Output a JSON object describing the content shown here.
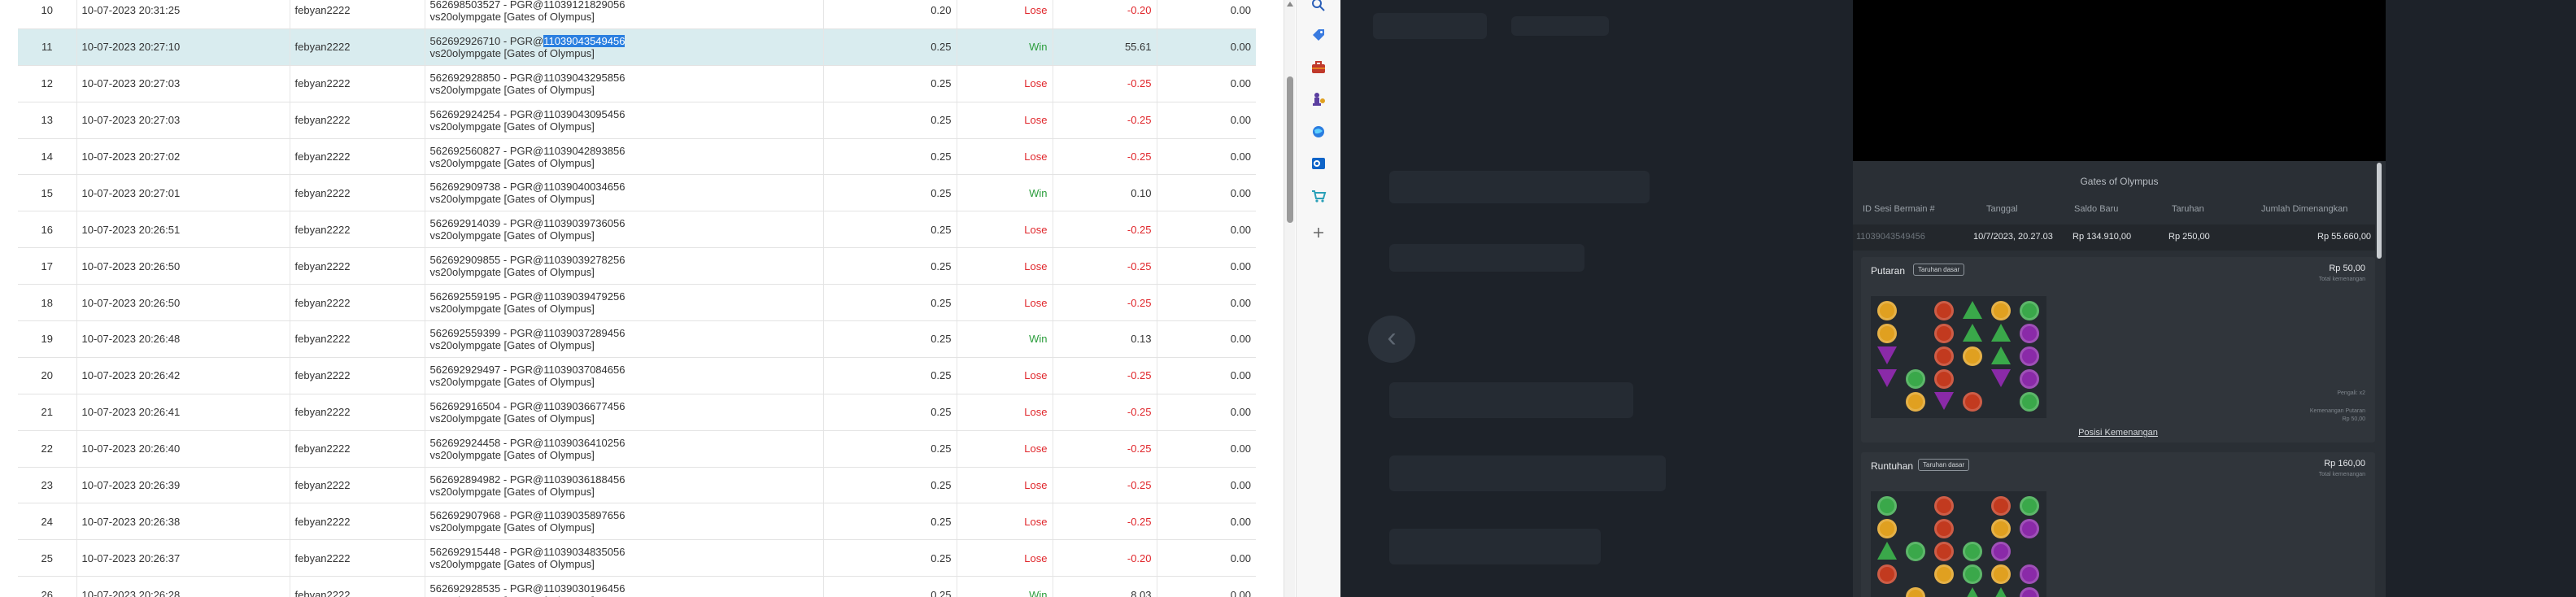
{
  "table": {
    "rows": [
      {
        "no": "10",
        "datetime": "10-07-2023 20:31:25",
        "user": "febyan2222",
        "ref_id": "562698503527",
        "ref_code": "PGR@11039121829056",
        "game": "vs20olympgate [Gates of Olympus]",
        "bet": "0.20",
        "result": "Lose",
        "winloss": "-0.20",
        "extra": "0.00"
      },
      {
        "no": "11",
        "datetime": "10-07-2023 20:27:10",
        "user": "febyan2222",
        "ref_id": "562692926710",
        "ref_code": "PGR@11039043549456",
        "game": "vs20olympgate [Gates of Olympus]",
        "bet": "0.25",
        "result": "Win",
        "winloss": "55.61",
        "extra": "0.00"
      },
      {
        "no": "12",
        "datetime": "10-07-2023 20:27:03",
        "user": "febyan2222",
        "ref_id": "562692928850",
        "ref_code": "PGR@11039043295856",
        "game": "vs20olympgate [Gates of Olympus]",
        "bet": "0.25",
        "result": "Lose",
        "winloss": "-0.25",
        "extra": "0.00"
      },
      {
        "no": "13",
        "datetime": "10-07-2023 20:27:03",
        "user": "febyan2222",
        "ref_id": "562692924254",
        "ref_code": "PGR@11039043095456",
        "game": "vs20olympgate [Gates of Olympus]",
        "bet": "0.25",
        "result": "Lose",
        "winloss": "-0.25",
        "extra": "0.00"
      },
      {
        "no": "14",
        "datetime": "10-07-2023 20:27:02",
        "user": "febyan2222",
        "ref_id": "562692560827",
        "ref_code": "PGR@11039042893856",
        "game": "vs20olympgate [Gates of Olympus]",
        "bet": "0.25",
        "result": "Lose",
        "winloss": "-0.25",
        "extra": "0.00"
      },
      {
        "no": "15",
        "datetime": "10-07-2023 20:27:01",
        "user": "febyan2222",
        "ref_id": "562692909738",
        "ref_code": "PGR@11039040034656",
        "game": "vs20olympgate [Gates of Olympus]",
        "bet": "0.25",
        "result": "Win",
        "winloss": "0.10",
        "extra": "0.00"
      },
      {
        "no": "16",
        "datetime": "10-07-2023 20:26:51",
        "user": "febyan2222",
        "ref_id": "562692914039",
        "ref_code": "PGR@11039039736056",
        "game": "vs20olympgate [Gates of Olympus]",
        "bet": "0.25",
        "result": "Lose",
        "winloss": "-0.25",
        "extra": "0.00"
      },
      {
        "no": "17",
        "datetime": "10-07-2023 20:26:50",
        "user": "febyan2222",
        "ref_id": "562692909855",
        "ref_code": "PGR@11039039278256",
        "game": "vs20olympgate [Gates of Olympus]",
        "bet": "0.25",
        "result": "Lose",
        "winloss": "-0.25",
        "extra": "0.00"
      },
      {
        "no": "18",
        "datetime": "10-07-2023 20:26:50",
        "user": "febyan2222",
        "ref_id": "562692559195",
        "ref_code": "PGR@11039039479256",
        "game": "vs20olympgate [Gates of Olympus]",
        "bet": "0.25",
        "result": "Lose",
        "winloss": "-0.25",
        "extra": "0.00"
      },
      {
        "no": "19",
        "datetime": "10-07-2023 20:26:48",
        "user": "febyan2222",
        "ref_id": "562692559399",
        "ref_code": "PGR@11039037289456",
        "game": "vs20olympgate [Gates of Olympus]",
        "bet": "0.25",
        "result": "Win",
        "winloss": "0.13",
        "extra": "0.00"
      },
      {
        "no": "20",
        "datetime": "10-07-2023 20:26:42",
        "user": "febyan2222",
        "ref_id": "562692929497",
        "ref_code": "PGR@11039037084656",
        "game": "vs20olympgate [Gates of Olympus]",
        "bet": "0.25",
        "result": "Lose",
        "winloss": "-0.25",
        "extra": "0.00"
      },
      {
        "no": "21",
        "datetime": "10-07-2023 20:26:41",
        "user": "febyan2222",
        "ref_id": "562692916504",
        "ref_code": "PGR@11039036677456",
        "game": "vs20olympgate [Gates of Olympus]",
        "bet": "0.25",
        "result": "Lose",
        "winloss": "-0.25",
        "extra": "0.00"
      },
      {
        "no": "22",
        "datetime": "10-07-2023 20:26:40",
        "user": "febyan2222",
        "ref_id": "562692924458",
        "ref_code": "PGR@11039036410256",
        "game": "vs20olympgate [Gates of Olympus]",
        "bet": "0.25",
        "result": "Lose",
        "winloss": "-0.25",
        "extra": "0.00"
      },
      {
        "no": "23",
        "datetime": "10-07-2023 20:26:39",
        "user": "febyan2222",
        "ref_id": "562692894982",
        "ref_code": "PGR@11039036188456",
        "game": "vs20olympgate [Gates of Olympus]",
        "bet": "0.25",
        "result": "Lose",
        "winloss": "-0.25",
        "extra": "0.00"
      },
      {
        "no": "24",
        "datetime": "10-07-2023 20:26:38",
        "user": "febyan2222",
        "ref_id": "562692907968",
        "ref_code": "PGR@11039035897656",
        "game": "vs20olympgate [Gates of Olympus]",
        "bet": "0.25",
        "result": "Lose",
        "winloss": "-0.25",
        "extra": "0.00"
      },
      {
        "no": "25",
        "datetime": "10-07-2023 20:26:37",
        "user": "febyan2222",
        "ref_id": "562692915448",
        "ref_code": "PGR@11039034835056",
        "game": "vs20olympgate [Gates of Olympus]",
        "bet": "0.25",
        "result": "Lose",
        "winloss": "-0.20",
        "extra": "0.00"
      },
      {
        "no": "26",
        "datetime": "10-07-2023 20:26:28",
        "user": "febyan2222",
        "ref_id": "562692928535",
        "ref_code": "PGR@11039030196456",
        "game": "vs20olympgate [Gates of Olympus]",
        "bet": "0.25",
        "result": "Win",
        "winloss": "8.03",
        "extra": "0.00"
      }
    ],
    "selected_row": "11",
    "selected_text": "11039043549456"
  },
  "sidebar": {
    "icons": [
      "search-icon",
      "tag-icon",
      "toolbox-icon",
      "chess-icon",
      "globe-icon",
      "outlook-icon",
      "shopping-cart-icon",
      "plus-icon"
    ]
  },
  "dark": {
    "back_glyph": "‹"
  },
  "panel": {
    "title": "Gates of Olympus",
    "headers": {
      "round_id": "ID Sesi Bermain #",
      "date": "Tanggal",
      "balance": "Saldo Baru",
      "bet": "Taruhan",
      "win": "Jumlah Dimenangkan"
    },
    "summary": {
      "round_id": "11039043549456",
      "date": "10/7/2023, 20.27.03",
      "balance": "Rp 134.910,00",
      "bet": "Rp 250,00",
      "win": "Rp 55.660,00"
    },
    "cards": [
      {
        "title": "Putaran",
        "badge": "Taruhan dasar",
        "amount": "Rp 50,00",
        "sub": "Total kemenangan",
        "note1": "Pengali: x2",
        "note2": "Kemenangan Putaran",
        "note3": "Rp 50,00",
        "link": "Posisi Kemenangan"
      },
      {
        "title": "Runtuhan",
        "badge": "Taruhan dasar",
        "amount": "Rp 160,00",
        "sub": "Total kemenangan"
      }
    ],
    "colors": {
      "gold": "#e0a020",
      "red": "#c23a1f",
      "green": "#3aa84a",
      "purple": "#8a2aa8",
      "blue_badge": "#2a7fe0"
    }
  }
}
